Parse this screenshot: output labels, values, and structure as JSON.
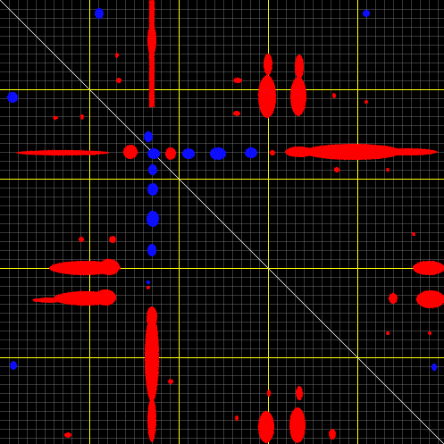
{
  "view": {
    "type": "2D NMR spectrum view",
    "background_color": "#000000",
    "minor_grid_color": "#8a8a8a",
    "major_grid_color": "#f0f000",
    "diagonal_color": "#cfcfcf",
    "positive_peak_color": "#ff0000",
    "negative_peak_color": "#1010ff",
    "grid_visible": true,
    "diagonal_visible": true
  }
}
